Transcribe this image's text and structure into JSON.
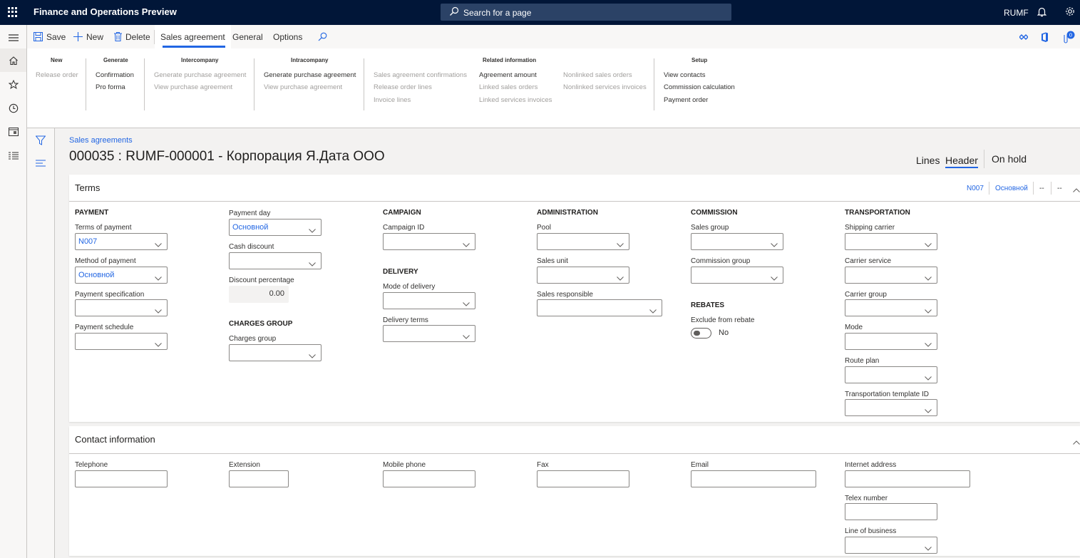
{
  "app": {
    "title": "Finance and Operations Preview",
    "search_placeholder": "Search for a page",
    "company": "RUMF",
    "notification_badge": "0"
  },
  "actions": {
    "save": "Save",
    "new": "New",
    "delete": "Delete",
    "tabs": [
      "Sales agreement",
      "General",
      "Options"
    ],
    "active_tab": "Sales agreement"
  },
  "ribbon": {
    "groups": [
      {
        "title": "New",
        "items": [
          {
            "label": "Release order",
            "enabled": false
          }
        ]
      },
      {
        "title": "Generate",
        "items": [
          {
            "label": "Confirmation",
            "enabled": true
          },
          {
            "label": "Pro forma",
            "enabled": true
          }
        ]
      },
      {
        "title": "Intercompany",
        "items": [
          {
            "label": "Generate purchase agreement",
            "enabled": false
          },
          {
            "label": "View purchase agreement",
            "enabled": false
          }
        ]
      },
      {
        "title": "Intracompany",
        "items": [
          {
            "label": "Generate purchase agreement",
            "enabled": true
          },
          {
            "label": "View purchase agreement",
            "enabled": false
          }
        ]
      },
      {
        "title": "Related information",
        "items": [
          {
            "label": "Sales agreement confirmations",
            "enabled": false
          },
          {
            "label": "Release order lines",
            "enabled": false
          },
          {
            "label": "Invoice lines",
            "enabled": false
          },
          {
            "label": "Agreement amount",
            "enabled": true
          },
          {
            "label": "Linked sales orders",
            "enabled": false
          },
          {
            "label": "Linked services invoices",
            "enabled": false
          },
          {
            "label": "Nonlinked sales orders",
            "enabled": false
          },
          {
            "label": "Nonlinked services invoices",
            "enabled": false
          }
        ]
      },
      {
        "title": "Setup",
        "items": [
          {
            "label": "View contacts",
            "enabled": true
          },
          {
            "label": "Commission calculation",
            "enabled": true
          },
          {
            "label": "Payment order",
            "enabled": true
          }
        ]
      }
    ]
  },
  "page": {
    "breadcrumb": "Sales agreements",
    "title": "000035 : RUMF-000001 - Корпорация Я.Дата ООО",
    "view_tabs": {
      "lines": "Lines",
      "header": "Header",
      "active": "Header"
    },
    "on_hold": "On hold"
  },
  "terms": {
    "title": "Terms",
    "summary": [
      "N007",
      "Основной",
      "--",
      "--"
    ],
    "payment": {
      "heading": "PAYMENT",
      "terms_of_payment": {
        "label": "Terms of payment",
        "value": "N007"
      },
      "method_of_payment": {
        "label": "Method of payment",
        "value": "Основной"
      },
      "payment_specification": {
        "label": "Payment specification",
        "value": ""
      },
      "payment_schedule": {
        "label": "Payment schedule",
        "value": ""
      },
      "payment_day": {
        "label": "Payment day",
        "value": "Основной"
      },
      "cash_discount": {
        "label": "Cash discount",
        "value": ""
      },
      "discount_percentage": {
        "label": "Discount percentage",
        "value": "0.00"
      }
    },
    "charges": {
      "heading": "CHARGES GROUP",
      "charges_group": {
        "label": "Charges group",
        "value": ""
      }
    },
    "campaign": {
      "heading": "CAMPAIGN",
      "campaign_id": {
        "label": "Campaign ID",
        "value": ""
      }
    },
    "delivery": {
      "heading": "DELIVERY",
      "mode_of_delivery": {
        "label": "Mode of delivery",
        "value": ""
      },
      "delivery_terms": {
        "label": "Delivery terms",
        "value": ""
      }
    },
    "administration": {
      "heading": "ADMINISTRATION",
      "pool": {
        "label": "Pool",
        "value": ""
      },
      "sales_unit": {
        "label": "Sales unit",
        "value": ""
      },
      "sales_responsible": {
        "label": "Sales responsible",
        "value": ""
      }
    },
    "commission": {
      "heading": "COMMISSION",
      "sales_group": {
        "label": "Sales group",
        "value": ""
      },
      "commission_group": {
        "label": "Commission group",
        "value": ""
      }
    },
    "rebates": {
      "heading": "REBATES",
      "exclude_from_rebate": {
        "label": "Exclude from rebate",
        "value": "No",
        "on": false
      }
    },
    "transportation": {
      "heading": "TRANSPORTATION",
      "shipping_carrier": {
        "label": "Shipping carrier",
        "value": ""
      },
      "carrier_service": {
        "label": "Carrier service",
        "value": ""
      },
      "carrier_group": {
        "label": "Carrier group",
        "value": ""
      },
      "mode": {
        "label": "Mode",
        "value": ""
      },
      "route_plan": {
        "label": "Route plan",
        "value": ""
      },
      "transportation_template_id": {
        "label": "Transportation template ID",
        "value": ""
      }
    }
  },
  "contact": {
    "title": "Contact information",
    "telephone": {
      "label": "Telephone",
      "value": ""
    },
    "extension": {
      "label": "Extension",
      "value": ""
    },
    "mobile_phone": {
      "label": "Mobile phone",
      "value": ""
    },
    "fax": {
      "label": "Fax",
      "value": ""
    },
    "email": {
      "label": "Email",
      "value": ""
    },
    "internet_address": {
      "label": "Internet address",
      "value": ""
    },
    "telex_number": {
      "label": "Telex number",
      "value": ""
    },
    "line_of_business": {
      "label": "Line of business",
      "value": ""
    }
  },
  "colors": {
    "navbar": "#011638",
    "accent": "#2266e3"
  }
}
